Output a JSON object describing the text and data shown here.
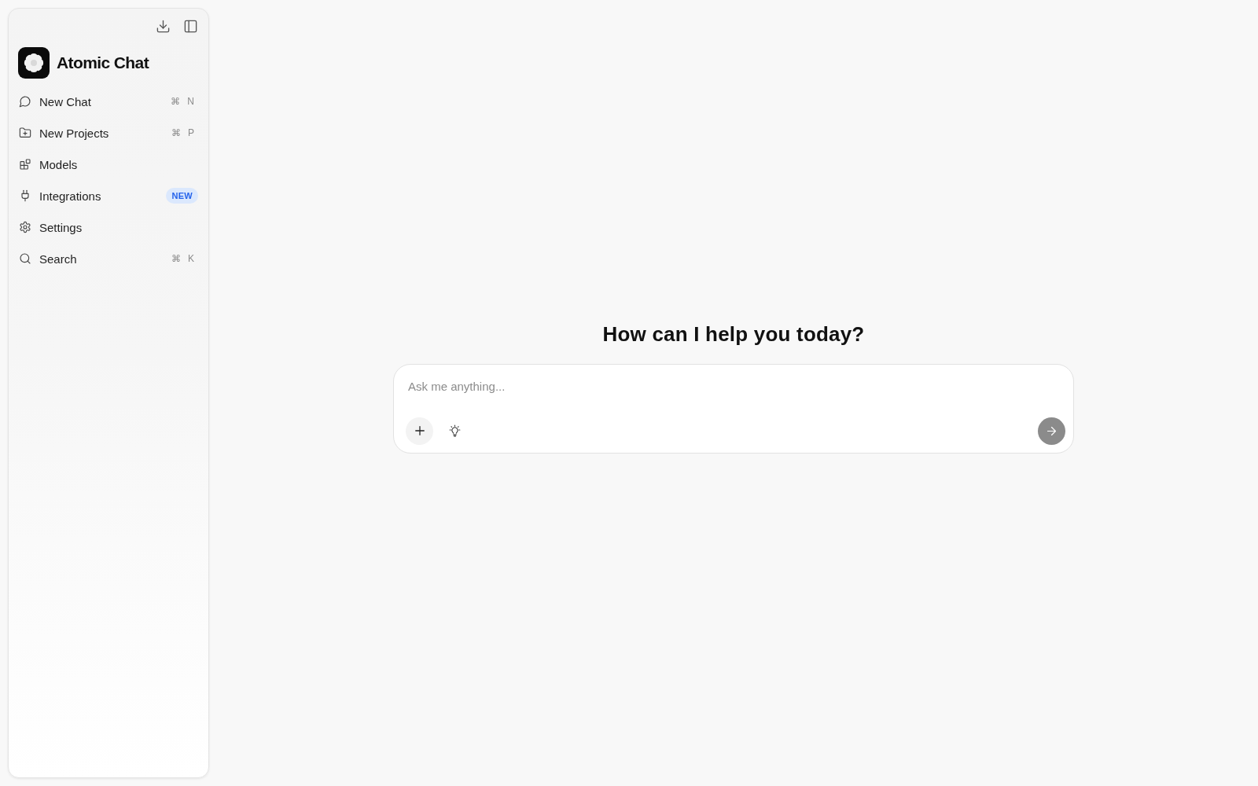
{
  "sidebar": {
    "brand": {
      "name": "Atomic Chat"
    },
    "nav": [
      {
        "label": "New Chat",
        "shortcut": "⌘ N"
      },
      {
        "label": "New Projects",
        "shortcut": "⌘ P"
      },
      {
        "label": "Models"
      },
      {
        "label": "Integrations",
        "badge": "NEW"
      },
      {
        "label": "Settings"
      },
      {
        "label": "Search",
        "shortcut": "⌘ K"
      }
    ]
  },
  "main": {
    "heading": "How can I help you today?",
    "composer": {
      "placeholder": "Ask me anything...",
      "send_button": {
        "disabled": true
      }
    }
  }
}
